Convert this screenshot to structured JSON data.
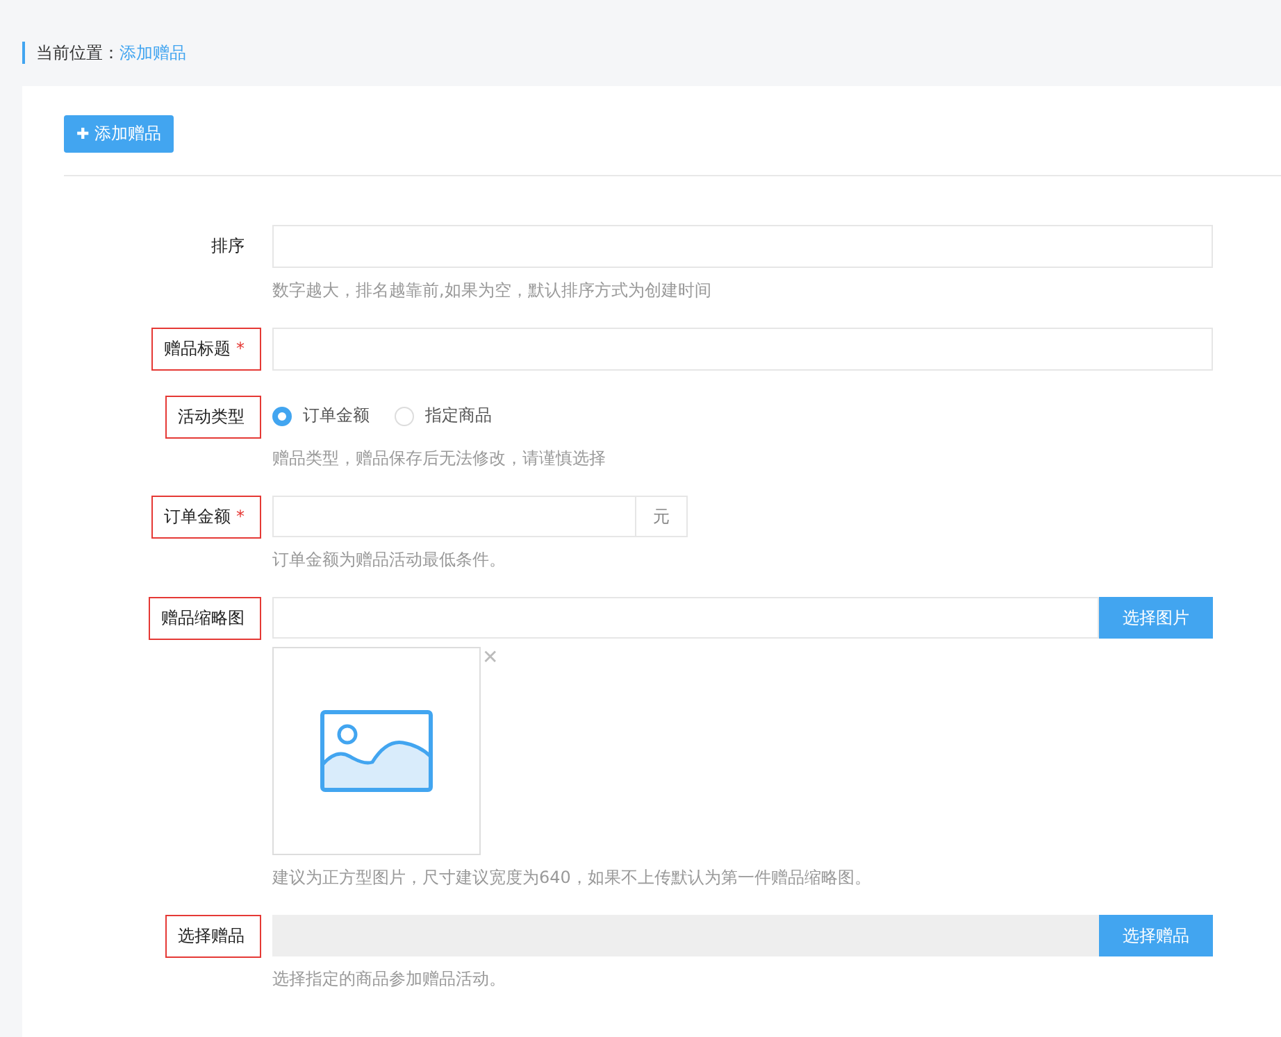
{
  "breadcrumb": {
    "label": "当前位置：",
    "current": "添加赠品"
  },
  "add_button": {
    "icon": "✚",
    "label": "添加赠品"
  },
  "fields": [
    {
      "kind": "text",
      "label": "排序",
      "highlighted": false,
      "help": "数字越大，排名越靠前,如果为空，默认排序方式为创建时间"
    },
    {
      "kind": "text",
      "label": "赠品标题",
      "required_mark": "*",
      "highlighted": true
    },
    {
      "kind": "radio",
      "label": "活动类型",
      "highlighted": true,
      "options": [
        {
          "label": "订单金额",
          "selected": true
        },
        {
          "label": "指定商品",
          "selected": false
        }
      ],
      "help": "赠品类型，赠品保存后无法修改，请谨慎选择"
    },
    {
      "kind": "addon",
      "label": "订单金额",
      "required_mark": "*",
      "highlighted": true,
      "addon": "元",
      "help": "订单金额为赠品活动最低条件。"
    },
    {
      "kind": "image",
      "label": "赠品缩略图",
      "highlighted": true,
      "button": "选择图片",
      "remove": "✕",
      "help": "建议为正方型图片，尺寸建议宽度为640，如果不上传默认为第一件赠品缩略图。"
    },
    {
      "kind": "picker",
      "label": "选择赠品",
      "highlighted": true,
      "button": "选择赠品",
      "help": "选择指定的商品参加赠品活动。"
    }
  ]
}
